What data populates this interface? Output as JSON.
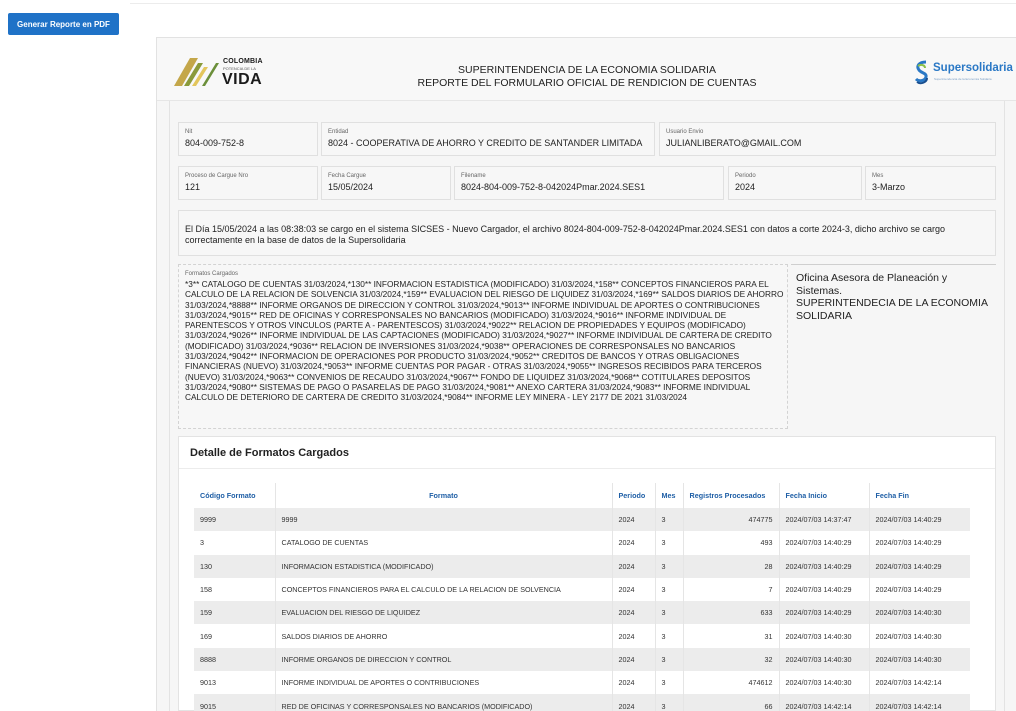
{
  "toolbar": {
    "pdf_button_label": "Generar Reporte en PDF"
  },
  "header": {
    "left_logo": {
      "line1": "COLOMBIA",
      "line2": "POTENCIA DE LA",
      "line3": "VIDA"
    },
    "title_line1": "SUPERINTENDENCIA DE LA ECONOMIA SOLIDARIA",
    "title_line2": "REPORTE DEL FORMULARIO OFICIAL DE RENDICION DE CUENTAS",
    "right_logo": {
      "name": "Supersolidaria",
      "tagline": "Superintendencia de la Economía Solidaria"
    }
  },
  "fields": {
    "nit": {
      "label": "Nit",
      "value": "804-009-752-8"
    },
    "entidad": {
      "label": "Entidad",
      "value": "8024 - COOPERATIVA DE AHORRO Y CREDITO DE SANTANDER LIMITADA"
    },
    "usuario": {
      "label": "Usuario Envio",
      "value": "JULIANLIBERATO@GMAIL.COM"
    },
    "proceso": {
      "label": "Proceso de Cargue Nro",
      "value": "121"
    },
    "fecha_cargue": {
      "label": "Fecha Cargue",
      "value": "15/05/2024"
    },
    "filename": {
      "label": "Filename",
      "value": "8024-804-009-752-8-042024Pmar.2024.SES1"
    },
    "periodo": {
      "label": "Periodo",
      "value": "2024"
    },
    "mes": {
      "label": "Mes",
      "value": "3-Marzo"
    }
  },
  "load_message": "El Día 15/05/2024 a las 08:38:03 se cargo en el sistema SICSES - Nuevo Cargador, el archivo 8024-804-009-752-8-042024Pmar.2024.SES1 con datos a corte 2024-3, dicho archivo se cargo correctamente en la base de datos de la Supersolidaria",
  "formatos": {
    "label": "Formatos Cargados",
    "text": "*3** CATALOGO DE CUENTAS 31/03/2024,*130** INFORMACION ESTADISTICA (MODIFICADO) 31/03/2024,*158** CONCEPTOS FINANCIEROS PARA EL CALCULO DE LA RELACION DE SOLVENCIA 31/03/2024,*159** EVALUACION DEL RIESGO DE LIQUIDEZ 31/03/2024,*169** SALDOS DIARIOS DE AHORRO 31/03/2024,*8888** INFORME ORGANOS DE DIRECCION Y CONTROL 31/03/2024,*9013** INFORME INDIVIDUAL DE APORTES O CONTRIBUCIONES 31/03/2024,*9015** RED DE OFICINAS Y CORRESPONSALES NO BANCARIOS (MODIFICADO) 31/03/2024,*9016** INFORME INDIVIDUAL DE PARENTESCOS Y OTROS VINCULOS (PARTE A - PARENTESCOS) 31/03/2024,*9022** RELACION DE PROPIEDADES Y EQUIPOS (MODIFICADO) 31/03/2024,*9026** INFORME INDIVIDUAL DE LAS CAPTACIONES (MODIFICADO) 31/03/2024,*9027** INFORME INDIVIDUAL DE CARTERA DE CREDITO (MODIFICADO) 31/03/2024,*9036** RELACION DE INVERSIONES 31/03/2024,*9038** OPERACIONES DE CORRESPONSALES NO BANCARIOS 31/03/2024,*9042** INFORMACION DE OPERACIONES POR PRODUCTO 31/03/2024,*9052** CREDITOS DE BANCOS Y OTRAS OBLIGACIONES FINANCIERAS (NUEVO) 31/03/2024,*9053** INFORME CUENTAS POR PAGAR - OTRAS 31/03/2024,*9055** INGRESOS RECIBIDOS PARA TERCEROS (NUEVO) 31/03/2024,*9063** CONVENIOS DE RECAUDO 31/03/2024,*9067** FONDO DE LIQUIDEZ 31/03/2024,*9068** COTITULARES DEPOSITOS 31/03/2024,*9080** SISTEMAS DE PAGO O PASARELAS DE PAGO 31/03/2024,*9081** ANEXO CARTERA 31/03/2024,*9083** INFORME INDIVIDUAL CALCULO DE DETERIORO DE CARTERA DE CREDITO 31/03/2024,*9084** INFORME LEY MINERA - LEY 2177 DE 2021 31/03/2024"
  },
  "oficina": {
    "line1": "Oficina Asesora de Planeación y Sistemas.",
    "line2": "SUPERINTENDECIA DE LA ECONOMIA SOLIDARIA"
  },
  "detail": {
    "title": "Detalle de Formatos Cargados",
    "columns": {
      "codigo": "Código Formato",
      "formato": "Formato",
      "periodo": "Periodo",
      "mes": "Mes",
      "registros": "Registros Procesados",
      "inicio": "Fecha Inicio",
      "fin": "Fecha Fin"
    },
    "rows": [
      {
        "codigo": "9999",
        "formato": "9999",
        "periodo": "2024",
        "mes": "3",
        "registros": "474775",
        "inicio": "2024/07/03 14:37:47",
        "fin": "2024/07/03 14:40:29"
      },
      {
        "codigo": "3",
        "formato": "CATALOGO DE CUENTAS",
        "periodo": "2024",
        "mes": "3",
        "registros": "493",
        "inicio": "2024/07/03 14:40:29",
        "fin": "2024/07/03 14:40:29"
      },
      {
        "codigo": "130",
        "formato": "INFORMACION ESTADISTICA (MODIFICADO)",
        "periodo": "2024",
        "mes": "3",
        "registros": "28",
        "inicio": "2024/07/03 14:40:29",
        "fin": "2024/07/03 14:40:29"
      },
      {
        "codigo": "158",
        "formato": "CONCEPTOS FINANCIEROS PARA EL CALCULO DE LA RELACION DE SOLVENCIA",
        "periodo": "2024",
        "mes": "3",
        "registros": "7",
        "inicio": "2024/07/03 14:40:29",
        "fin": "2024/07/03 14:40:29"
      },
      {
        "codigo": "159",
        "formato": "EVALUACION DEL RIESGO DE LIQUIDEZ",
        "periodo": "2024",
        "mes": "3",
        "registros": "633",
        "inicio": "2024/07/03 14:40:29",
        "fin": "2024/07/03 14:40:30"
      },
      {
        "codigo": "169",
        "formato": "SALDOS DIARIOS DE AHORRO",
        "periodo": "2024",
        "mes": "3",
        "registros": "31",
        "inicio": "2024/07/03 14:40:30",
        "fin": "2024/07/03 14:40:30"
      },
      {
        "codigo": "8888",
        "formato": "INFORME ORGANOS DE DIRECCION Y CONTROL",
        "periodo": "2024",
        "mes": "3",
        "registros": "32",
        "inicio": "2024/07/03 14:40:30",
        "fin": "2024/07/03 14:40:30"
      },
      {
        "codigo": "9013",
        "formato": "INFORME INDIVIDUAL DE APORTES O CONTRIBUCIONES",
        "periodo": "2024",
        "mes": "3",
        "registros": "474612",
        "inicio": "2024/07/03 14:40:30",
        "fin": "2024/07/03 14:42:14"
      },
      {
        "codigo": "9015",
        "formato": "RED DE OFICINAS Y CORRESPONSALES NO BANCARIOS (MODIFICADO)",
        "periodo": "2024",
        "mes": "3",
        "registros": "66",
        "inicio": "2024/07/03 14:42:14",
        "fin": "2024/07/03 14:42:14"
      }
    ]
  }
}
